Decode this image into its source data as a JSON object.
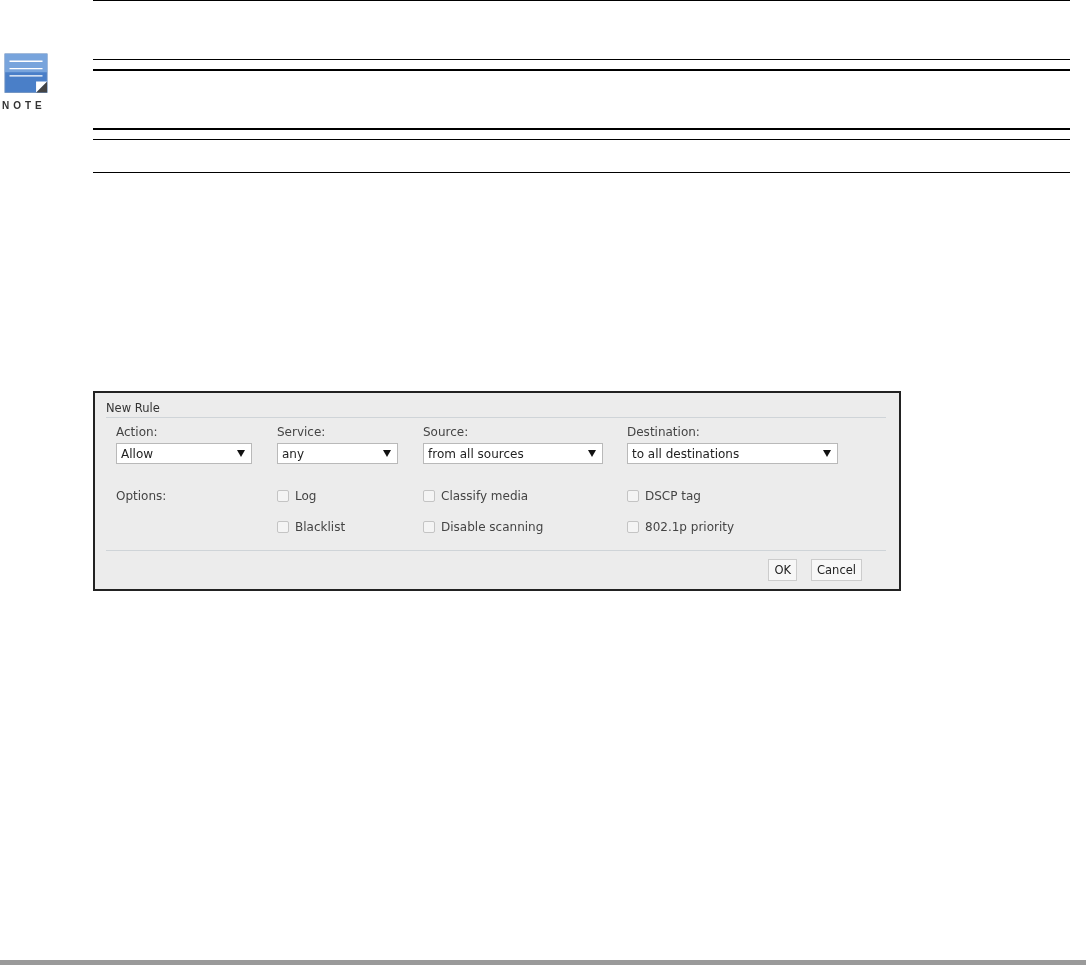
{
  "note": {
    "label": "NOTE"
  },
  "dialog": {
    "title": "New Rule",
    "fields": [
      {
        "label": "Action:",
        "value": "Allow"
      },
      {
        "label": "Service:",
        "value": "any"
      },
      {
        "label": "Source:",
        "value": "from all sources"
      },
      {
        "label": "Destination:",
        "value": "to all destinations"
      }
    ],
    "options_label": "Options:",
    "option_columns": [
      [
        {
          "label": "Log",
          "checked": false
        },
        {
          "label": "Blacklist",
          "checked": false
        }
      ],
      [
        {
          "label": "Classify media",
          "checked": false
        },
        {
          "label": "Disable scanning",
          "checked": false
        }
      ],
      [
        {
          "label": "DSCP tag",
          "checked": false
        },
        {
          "label": "802.1p priority",
          "checked": false
        }
      ]
    ],
    "buttons": [
      "OK",
      "Cancel"
    ]
  }
}
